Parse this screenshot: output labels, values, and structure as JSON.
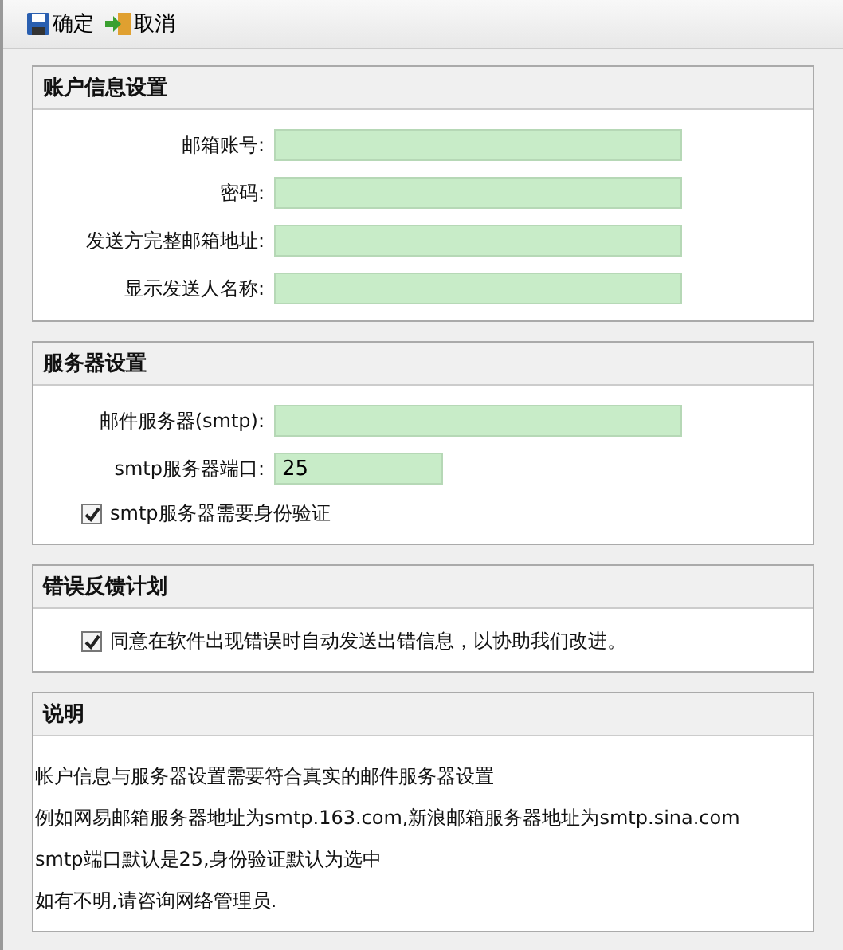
{
  "toolbar": [
    {
      "label": "确定",
      "kind": "save"
    },
    {
      "label": "取消",
      "kind": "cancel"
    }
  ],
  "sections": [
    {
      "title": "账户信息设置",
      "rows": [
        {
          "kind": "field",
          "label": "邮箱账号:"
        },
        {
          "kind": "field",
          "label": "密码:"
        },
        {
          "kind": "field",
          "label": "发送方完整邮箱地址:"
        },
        {
          "kind": "field",
          "label": "显示发送人名称:"
        }
      ]
    },
    {
      "title": "服务器设置",
      "rows": [
        {
          "kind": "field",
          "label": "邮件服务器(smtp):"
        },
        {
          "kind": "shortfield",
          "label": "smtp服务器端口:",
          "value": "25"
        },
        {
          "kind": "checkbox",
          "label": "smtp服务器需要身份验证",
          "checked": true
        }
      ]
    },
    {
      "title": "错误反馈计划",
      "rows": [
        {
          "kind": "checkbox",
          "label": "同意在软件出现错误时自动发送出错信息，以协助我们改进。",
          "checked": true
        }
      ]
    },
    {
      "title": "说明",
      "rows": [
        {
          "kind": "note",
          "text": "帐户信息与服务器设置需要符合真实的邮件服务器设置"
        },
        {
          "kind": "note",
          "text": "例如网易邮箱服务器地址为smtp.163.com,新浪邮箱服务器地址为smtp.sina.com"
        },
        {
          "kind": "note",
          "text": "smtp端口默认是25,身份验证默认为选中"
        },
        {
          "kind": "note",
          "text": "如有不明,请咨询网络管理员."
        }
      ]
    }
  ]
}
